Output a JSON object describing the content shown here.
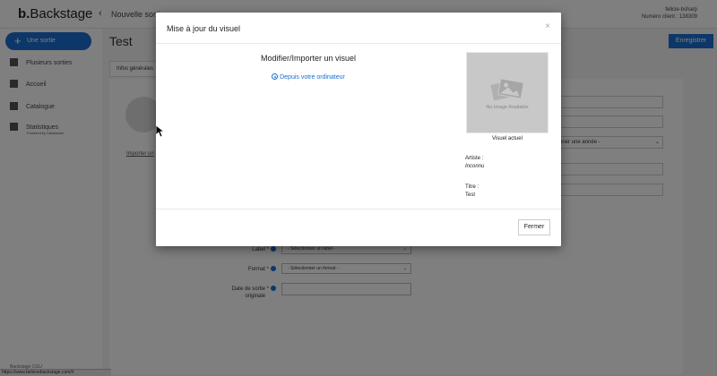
{
  "app": {
    "logo_letter": "b.",
    "logo_text": "Backstage",
    "breadcrumb": "Nouvelle sortie",
    "user_name": "felicie-bsharp",
    "client_number": "Numéro client : 138309"
  },
  "sidebar": {
    "new_release": "Une sortie",
    "items": [
      {
        "label": "Plusieurs sorties"
      },
      {
        "label": "Accueil"
      },
      {
        "label": "Catalogue"
      },
      {
        "label": "Statistiques",
        "sub": "Powered by Datamusic"
      }
    ],
    "footer": "Backstage CGU"
  },
  "main": {
    "title": "Test",
    "save_label": "Enregistrer",
    "tab": "Infos générales",
    "import_link": "Importer un",
    "year_select": "nner une année -",
    "label_field": {
      "label": "Label",
      "value": "- Sélectionner un label -"
    },
    "format_field": {
      "label": "Format",
      "value": "- Sélectionner un format -"
    },
    "date_field": {
      "label": "Date de sortie",
      "label2": "originale"
    }
  },
  "status_url": "https://www.believebackstage.com/#",
  "modal": {
    "title": "Mise à jour du visuel",
    "subtitle": "Modifier/Importer un visuel",
    "upload_link": "Depuis votre ordinateur",
    "no_image": "No Image Available",
    "caption": "Visuel actuel",
    "artist_label": "Artiste :",
    "artist_value": "Inconnu",
    "title_label": "Titre :",
    "title_value": "Test",
    "close_label": "Fermer"
  }
}
